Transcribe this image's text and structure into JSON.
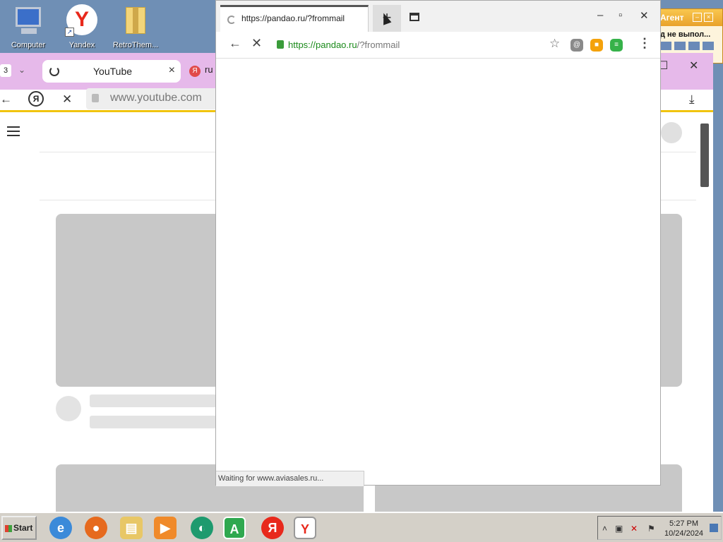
{
  "desktop": {
    "icons": [
      {
        "label": "Computer"
      },
      {
        "label": "Yandex"
      },
      {
        "label": "RetroThem..."
      }
    ]
  },
  "agent_window": {
    "title": "Агент",
    "message": "д не выпол..."
  },
  "background_browser": {
    "tab_count": "3",
    "active_tab_title": "YouTube",
    "other_tab_title": "ru",
    "address_url": "www.youtube.com"
  },
  "popup": {
    "tab_title": "https://pandao.ru/?frommail",
    "url_scheme": "https://",
    "url_host": "pandao.ru",
    "url_path": "/?frommail",
    "status_text": "Waiting for www.aviasales.ru..."
  },
  "taskbar": {
    "start_label": "Start",
    "clock_time": "5:27 PM",
    "clock_date": "10/24/2024"
  }
}
